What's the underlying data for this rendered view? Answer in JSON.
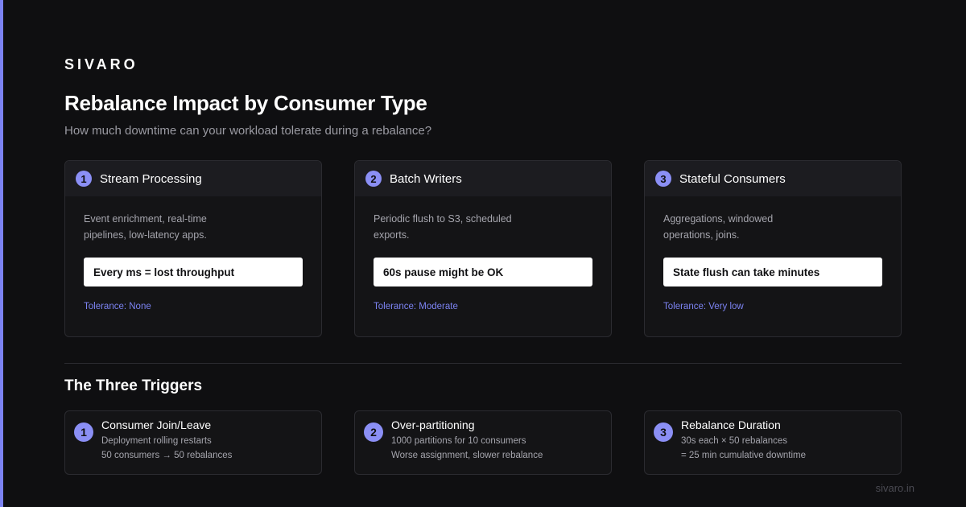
{
  "brand": "SIVARO",
  "title": "Rebalance Impact by Consumer Type",
  "subtitle": "How much downtime can your workload tolerate during a rebalance?",
  "cards": [
    {
      "num": "1",
      "title": "Stream Processing",
      "desc": "Event enrichment, real-time pipelines, low-latency apps.",
      "pill": "Every ms = lost throughput",
      "tolerance": "Tolerance: None"
    },
    {
      "num": "2",
      "title": "Batch Writers",
      "desc": "Periodic flush to S3, scheduled exports.",
      "pill": "60s pause might be OK",
      "tolerance": "Tolerance: Moderate"
    },
    {
      "num": "3",
      "title": "Stateful Consumers",
      "desc": "Aggregations, windowed operations, joins.",
      "pill": "State flush can take minutes",
      "tolerance": "Tolerance: Very low"
    }
  ],
  "section_title": "The Three Triggers",
  "triggers": [
    {
      "num": "1",
      "title": "Consumer Join/Leave",
      "line1": "Deployment rolling restarts",
      "line2": "50 consumers → 50 rebalances"
    },
    {
      "num": "2",
      "title": "Over-partitioning",
      "line1": "1000 partitions for 10 consumers",
      "line2": "Worse assignment, slower rebalance"
    },
    {
      "num": "3",
      "title": "Rebalance Duration",
      "line1": "30s each × 50 rebalances",
      "line2": "= 25 min cumulative downtime"
    }
  ],
  "footer": "sivaro.in",
  "colors": {
    "accent": "#7c83f2",
    "background": "#0f0f11",
    "card": "#141416",
    "card_header": "#1c1c20"
  }
}
